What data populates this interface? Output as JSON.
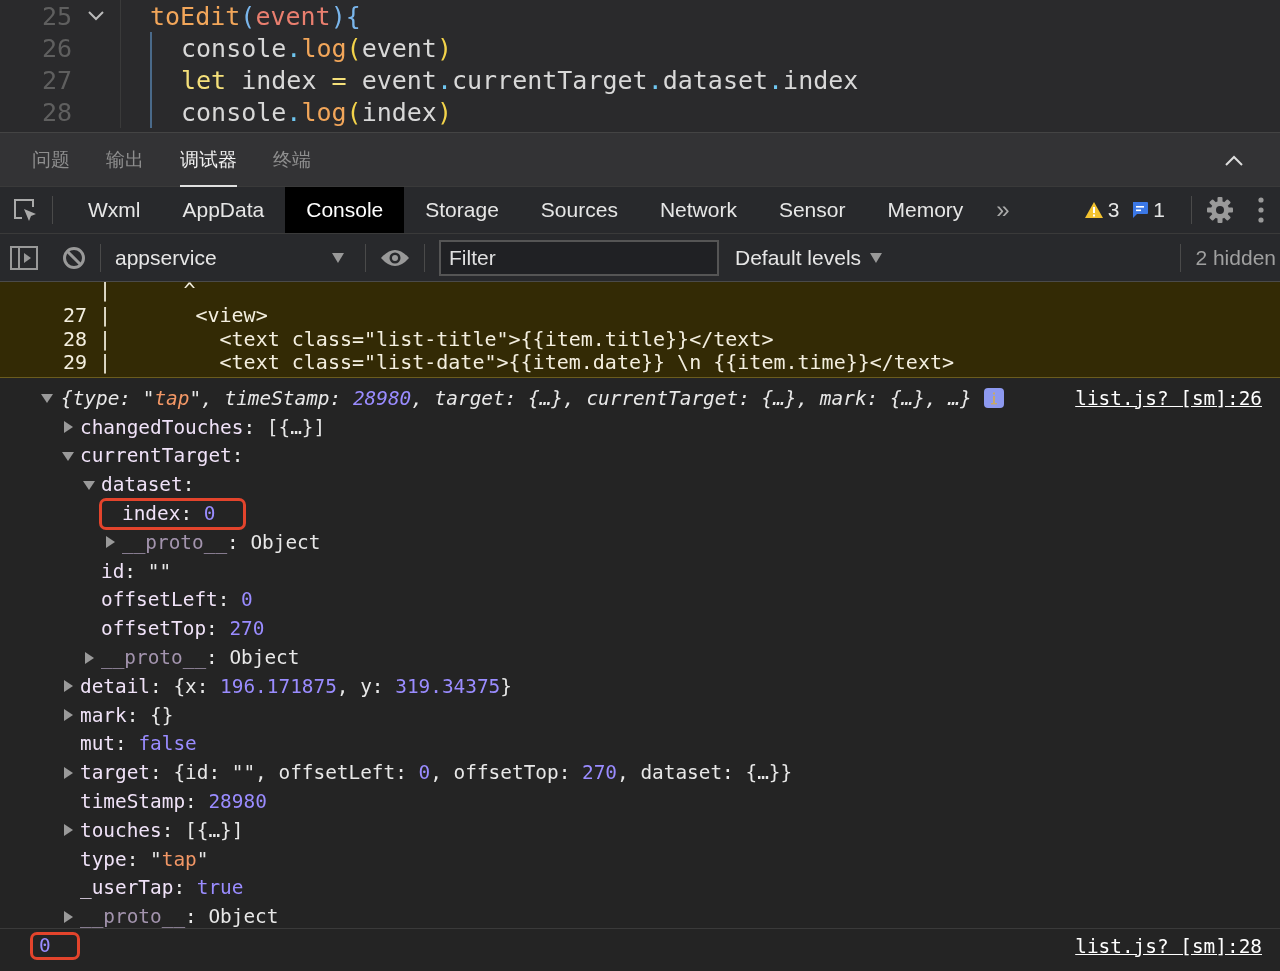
{
  "editor": {
    "lines": [
      {
        "number": "25",
        "expanded": true,
        "tokens": [
          {
            "kind": "fn",
            "text": "toEdit"
          },
          {
            "kind": "b1",
            "text": "("
          },
          {
            "kind": "param",
            "text": "event"
          },
          {
            "kind": "b1",
            "text": "){"
          }
        ],
        "children": [
          {
            "number": "26",
            "tokens": [
              {
                "kind": "plain",
                "text": "console"
              },
              {
                "kind": "dot",
                "text": "."
              },
              {
                "kind": "fn",
                "text": "log"
              },
              {
                "kind": "b2",
                "text": "("
              },
              {
                "kind": "plain",
                "text": "event"
              },
              {
                "kind": "b2",
                "text": ")"
              }
            ]
          },
          {
            "number": "27",
            "tokens": [
              {
                "kind": "kw",
                "text": "let"
              },
              {
                "kind": "plain",
                "text": " index "
              },
              {
                "kind": "kw",
                "text": "="
              },
              {
                "kind": "plain",
                "text": " event"
              },
              {
                "kind": "dot",
                "text": "."
              },
              {
                "kind": "plain",
                "text": "currentTarget"
              },
              {
                "kind": "dot",
                "text": "."
              },
              {
                "kind": "plain",
                "text": "dataset"
              },
              {
                "kind": "dot",
                "text": "."
              },
              {
                "kind": "plain",
                "text": "index"
              }
            ]
          },
          {
            "number": "28",
            "tokens": [
              {
                "kind": "plain",
                "text": "console"
              },
              {
                "kind": "dot",
                "text": "."
              },
              {
                "kind": "fn",
                "text": "log"
              },
              {
                "kind": "b2",
                "text": "("
              },
              {
                "kind": "plain",
                "text": "index"
              },
              {
                "kind": "b2",
                "text": ")"
              }
            ]
          }
        ]
      }
    ]
  },
  "panel_tabs": [
    {
      "label": "问题",
      "selected": false
    },
    {
      "label": "输出",
      "selected": false
    },
    {
      "label": "调试器",
      "selected": true
    },
    {
      "label": "终端",
      "selected": false
    }
  ],
  "devtools": {
    "tabs": [
      {
        "label": "Wxml",
        "selected": false
      },
      {
        "label": "AppData",
        "selected": false
      },
      {
        "label": "Console",
        "selected": true
      },
      {
        "label": "Storage",
        "selected": false
      },
      {
        "label": "Sources",
        "selected": false
      },
      {
        "label": "Network",
        "selected": false
      },
      {
        "label": "Sensor",
        "selected": false
      },
      {
        "label": "Memory",
        "selected": false
      }
    ],
    "more": "»",
    "warnings": "3",
    "messages": "1"
  },
  "console_toolbar": {
    "context": "appservice",
    "filter": {
      "placeholder": "Filter"
    },
    "levels": "Default levels",
    "hidden": "2 hidden"
  },
  "error_snippet": {
    "lines": [
      "   |      ^",
      "27 |       <view>",
      "28 |         <text class=\"list-title\">{{item.title}}</text>",
      "29 |         <text class=\"list-date\">{{item.date}} \\n {{item.time}}</text>"
    ]
  },
  "console": {
    "entries": [
      {
        "kind": "object",
        "source": "list.js? [sm]:26",
        "expanded": true,
        "summary": [
          {
            "kind": "plain",
            "text": "{type: \""
          },
          {
            "kind": "str",
            "text": "tap"
          },
          {
            "kind": "plain",
            "text": "\", timeStamp: "
          },
          {
            "kind": "num",
            "text": "28980"
          },
          {
            "kind": "plain",
            "text": ", target: {…}, currentTarget: {…}, mark: {…}, …}"
          }
        ],
        "children": [
          {
            "expanded": false,
            "tokens": [
              {
                "kind": "key",
                "text": "changedTouches"
              },
              {
                "kind": "plain",
                "text": ": [{…}]"
              }
            ]
          },
          {
            "expanded": true,
            "tokens": [
              {
                "kind": "key",
                "text": "currentTarget"
              },
              {
                "kind": "plain",
                "text": ":"
              }
            ],
            "children": [
              {
                "expanded": true,
                "tokens": [
                  {
                    "kind": "key",
                    "text": "dataset"
                  },
                  {
                    "kind": "plain",
                    "text": ":"
                  }
                ],
                "children": [
                  {
                    "highlighted": true,
                    "tokens": [
                      {
                        "kind": "key",
                        "text": "index"
                      },
                      {
                        "kind": "plain",
                        "text": ": "
                      },
                      {
                        "kind": "num",
                        "text": "0"
                      }
                    ]
                  },
                  {
                    "expanded": false,
                    "tokens": [
                      {
                        "kind": "dim",
                        "text": "__proto__"
                      },
                      {
                        "kind": "plain",
                        "text": ": Object"
                      }
                    ]
                  }
                ]
              },
              {
                "tokens": [
                  {
                    "kind": "key",
                    "text": "id"
                  },
                  {
                    "kind": "plain",
                    "text": ": \"\""
                  }
                ]
              },
              {
                "tokens": [
                  {
                    "kind": "key",
                    "text": "offsetLeft"
                  },
                  {
                    "kind": "plain",
                    "text": ": "
                  },
                  {
                    "kind": "num",
                    "text": "0"
                  }
                ]
              },
              {
                "tokens": [
                  {
                    "kind": "key",
                    "text": "offsetTop"
                  },
                  {
                    "kind": "plain",
                    "text": ": "
                  },
                  {
                    "kind": "num",
                    "text": "270"
                  }
                ]
              },
              {
                "expanded": false,
                "tokens": [
                  {
                    "kind": "dim",
                    "text": "__proto__"
                  },
                  {
                    "kind": "plain",
                    "text": ": Object"
                  }
                ]
              }
            ]
          },
          {
            "expanded": false,
            "tokens": [
              {
                "kind": "key",
                "text": "detail"
              },
              {
                "kind": "plain",
                "text": ": {x: "
              },
              {
                "kind": "num",
                "text": "196.171875"
              },
              {
                "kind": "plain",
                "text": ", y: "
              },
              {
                "kind": "num",
                "text": "319.34375"
              },
              {
                "kind": "plain",
                "text": "}"
              }
            ]
          },
          {
            "expanded": false,
            "tokens": [
              {
                "kind": "key",
                "text": "mark"
              },
              {
                "kind": "plain",
                "text": ": {}"
              }
            ]
          },
          {
            "tokens": [
              {
                "kind": "key",
                "text": "mut"
              },
              {
                "kind": "plain",
                "text": ": "
              },
              {
                "kind": "num",
                "text": "false"
              }
            ]
          },
          {
            "expanded": false,
            "tokens": [
              {
                "kind": "key",
                "text": "target"
              },
              {
                "kind": "plain",
                "text": ": {id: \"\", offsetLeft: "
              },
              {
                "kind": "num",
                "text": "0"
              },
              {
                "kind": "plain",
                "text": ", offsetTop: "
              },
              {
                "kind": "num",
                "text": "270"
              },
              {
                "kind": "plain",
                "text": ", dataset: {…}}"
              }
            ]
          },
          {
            "tokens": [
              {
                "kind": "key",
                "text": "timeStamp"
              },
              {
                "kind": "plain",
                "text": ": "
              },
              {
                "kind": "num",
                "text": "28980"
              }
            ]
          },
          {
            "expanded": false,
            "tokens": [
              {
                "kind": "key",
                "text": "touches"
              },
              {
                "kind": "plain",
                "text": ": [{…}]"
              }
            ]
          },
          {
            "tokens": [
              {
                "kind": "key",
                "text": "type"
              },
              {
                "kind": "plain",
                "text": ": \""
              },
              {
                "kind": "str",
                "text": "tap"
              },
              {
                "kind": "plain",
                "text": "\""
              }
            ]
          },
          {
            "tokens": [
              {
                "kind": "key",
                "text": "_userTap"
              },
              {
                "kind": "plain",
                "text": ": "
              },
              {
                "kind": "num",
                "text": "true"
              }
            ]
          },
          {
            "expanded": false,
            "tokens": [
              {
                "kind": "dim",
                "text": "__proto__"
              },
              {
                "kind": "plain",
                "text": ": Object"
              }
            ]
          }
        ]
      },
      {
        "kind": "value",
        "source": "list.js? [sm]:28",
        "value": "0",
        "highlighted": true
      }
    ]
  }
}
